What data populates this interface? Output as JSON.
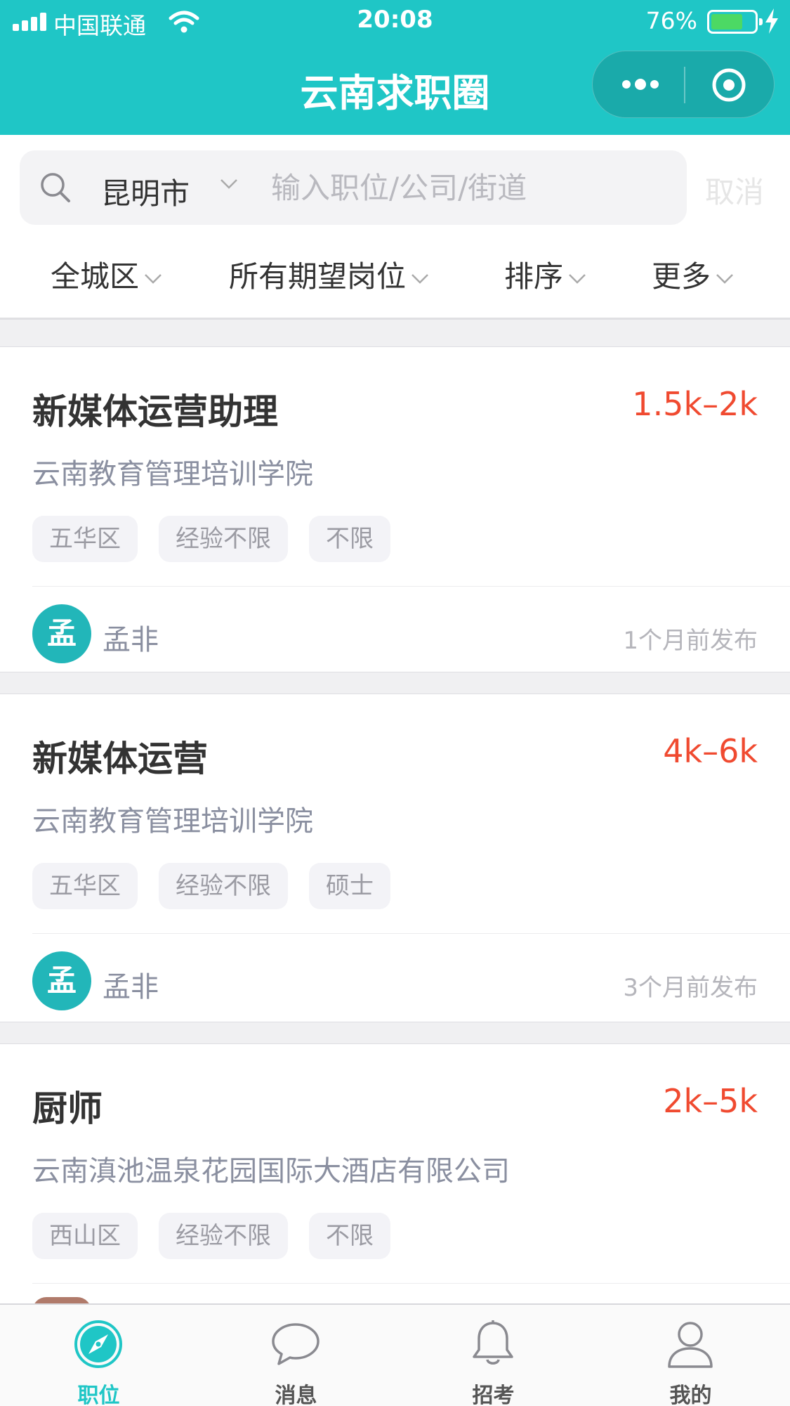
{
  "status_bar": {
    "carrier": "中国联通",
    "time": "20:08",
    "battery_percent": "76%",
    "battery_level": 0.76
  },
  "header": {
    "title": "云南求职圈",
    "accent_color": "#1fc6c6"
  },
  "search": {
    "city": "昆明市",
    "placeholder": "输入职位/公司/街道",
    "value": "",
    "cancel_label": "取消"
  },
  "filters": [
    {
      "label": "全城区"
    },
    {
      "label": "所有期望岗位"
    },
    {
      "label": "排序"
    },
    {
      "label": "更多"
    }
  ],
  "jobs": [
    {
      "title": "新媒体运营助理",
      "salary": "1.5k–2k",
      "company": "云南教育管理培训学院",
      "tags": [
        "五华区",
        "经验不限",
        "不限"
      ],
      "recruiter_initial": "孟",
      "recruiter": "孟非",
      "posted": "1个月前发布"
    },
    {
      "title": "新媒体运营",
      "salary": "4k–6k",
      "company": "云南教育管理培训学院",
      "tags": [
        "五华区",
        "经验不限",
        "硕士"
      ],
      "recruiter_initial": "孟",
      "recruiter": "孟非",
      "posted": "3个月前发布"
    },
    {
      "title": "厨师",
      "salary": "2k–5k",
      "company": "云南滇池温泉花园国际大酒店有限公司",
      "tags": [
        "西山区",
        "经验不限",
        "不限"
      ]
    }
  ],
  "tabbar": {
    "items": [
      {
        "label": "职位",
        "icon": "compass-icon",
        "active": true
      },
      {
        "label": "消息",
        "icon": "chat-bubble-icon",
        "active": false
      },
      {
        "label": "招考",
        "icon": "bell-icon",
        "active": false
      },
      {
        "label": "我的",
        "icon": "user-icon",
        "active": false
      }
    ]
  }
}
